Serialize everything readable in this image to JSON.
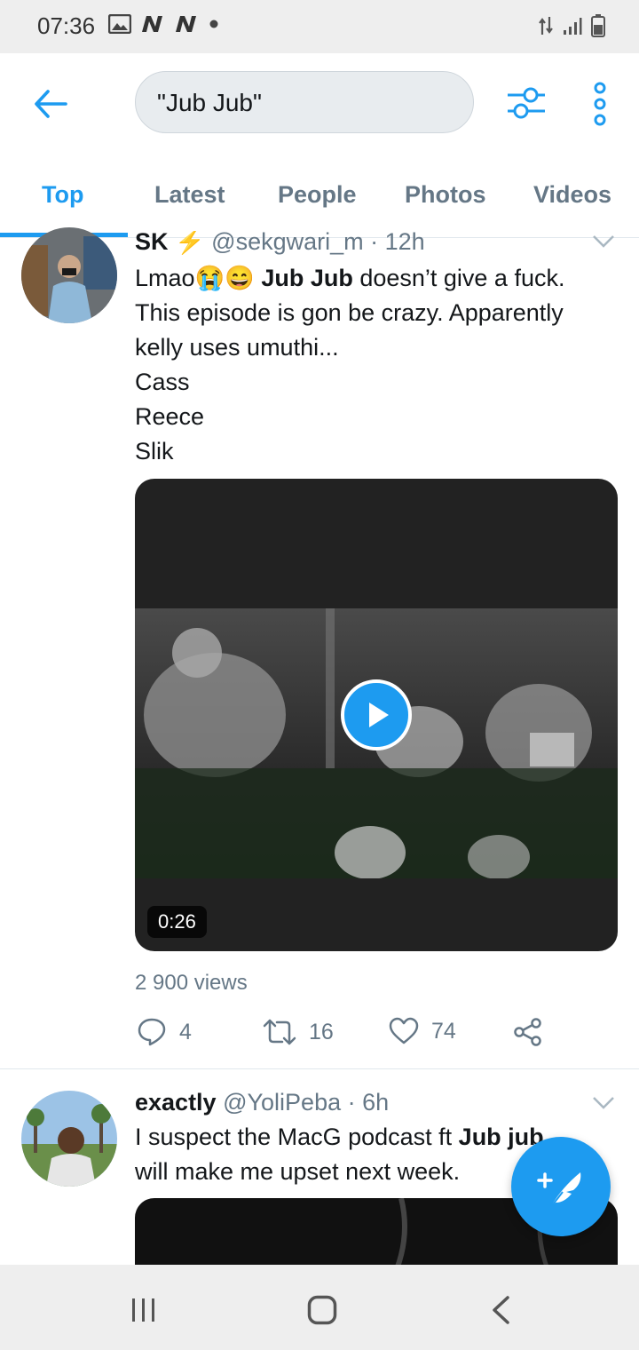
{
  "status_bar": {
    "time": "07:36",
    "icons": [
      "image-icon",
      "n-icon",
      "n-icon",
      "dot-icon",
      "data-arrows-icon",
      "signal-icon",
      "battery-icon"
    ]
  },
  "header": {
    "search_value": "\"Jub Jub\"",
    "icons": [
      "back-arrow-icon",
      "filter-sliders-icon",
      "more-vertical-icon"
    ]
  },
  "tabs": [
    {
      "label": "Top",
      "active": true
    },
    {
      "label": "Latest",
      "active": false
    },
    {
      "label": "People",
      "active": false
    },
    {
      "label": "Photos",
      "active": false
    },
    {
      "label": "Videos",
      "active": false
    }
  ],
  "tweet1": {
    "name": "SK",
    "handle": "@sekgwari_m",
    "time": "12h",
    "text_prefix": "Lmao",
    "emoji": "😭😄",
    "highlight": "Jub Jub",
    "text_line1_rest": " doesn’t give a fuck.",
    "text_line2": "This episode is gon be crazy. Apparently",
    "text_line3": "kelly uses umuthi...",
    "text_line4": "Cass",
    "text_line5": "Reece",
    "text_line6": "Slik",
    "video_duration": "0:26",
    "views": "2 900 views",
    "replies": "4",
    "retweets": "16",
    "likes": "74"
  },
  "tweet2": {
    "name": "exactly",
    "handle": "@YoliPeba",
    "time": "6h",
    "text_line1": "I suspect the MacG podcast ft ",
    "highlight": "Jub jub",
    "text_line2": "will make me upset next week."
  },
  "colors": {
    "accent": "#1d9bf0",
    "secondary_text": "#657786",
    "primary_text": "#14171a"
  }
}
